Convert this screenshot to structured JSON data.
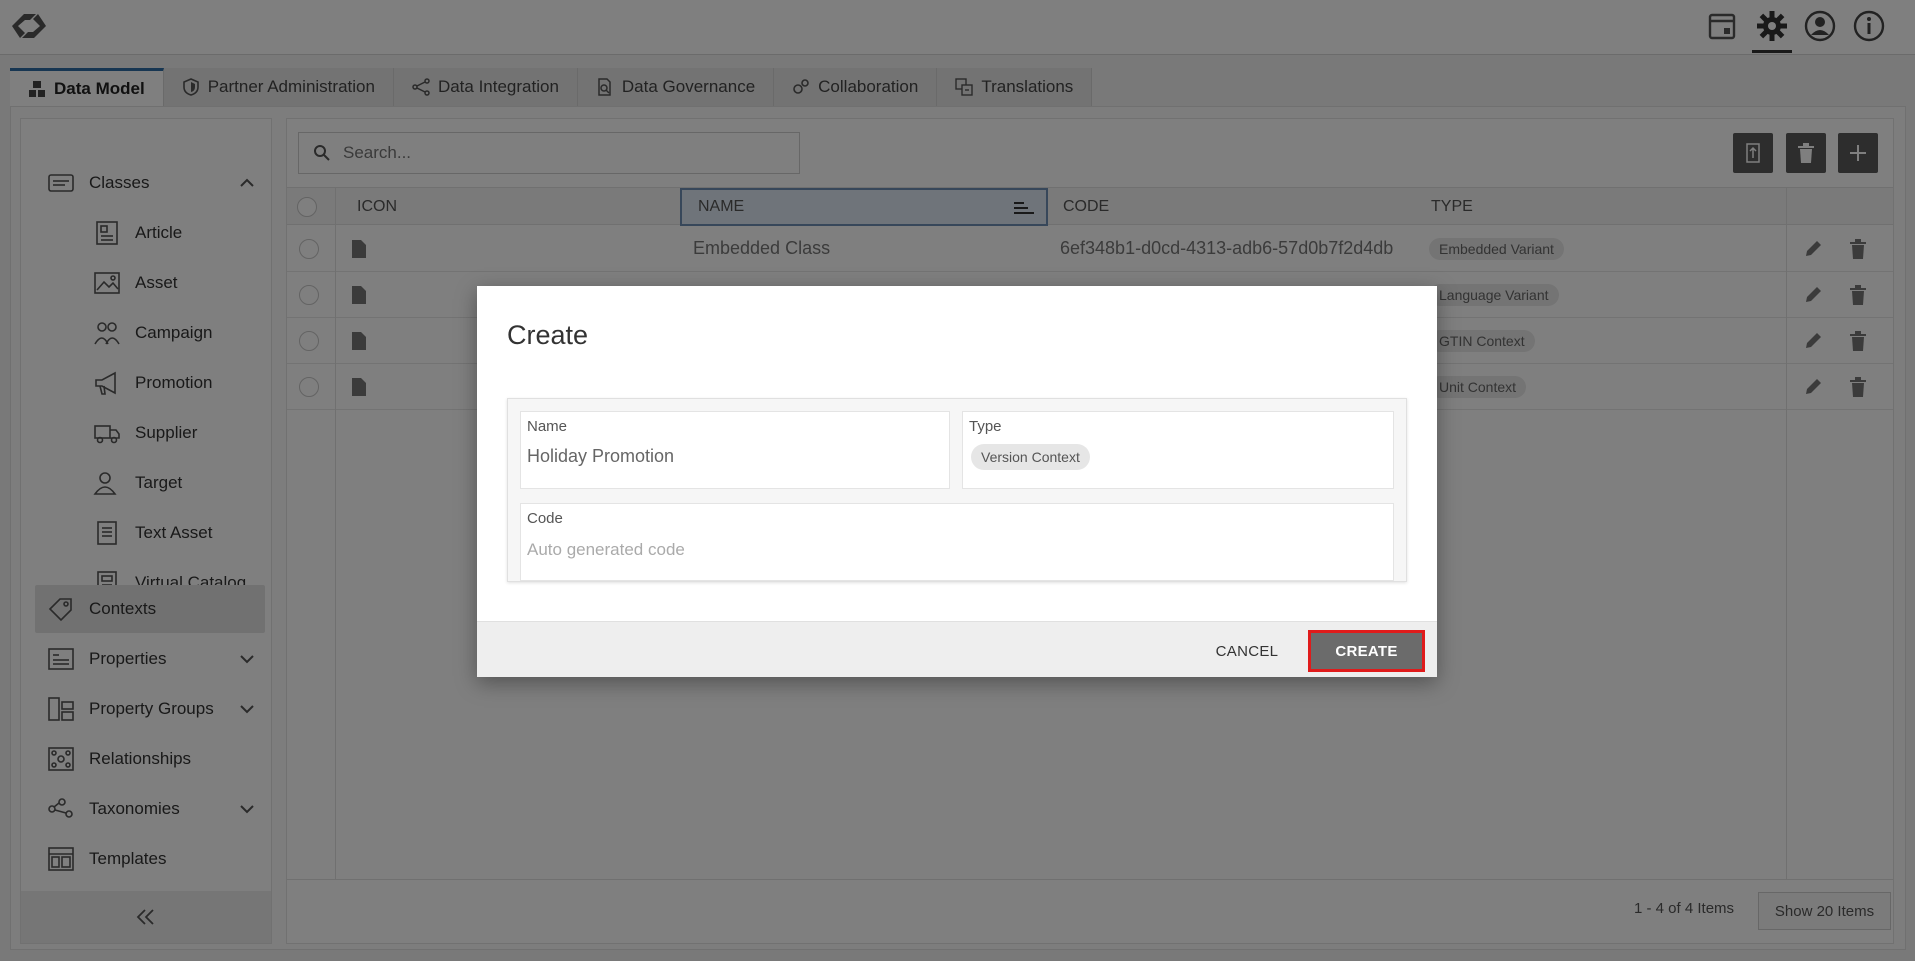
{
  "tabs": [
    {
      "label": "Data Model",
      "icon": "cubes-icon"
    },
    {
      "label": "Partner Administration",
      "icon": "shield-icon"
    },
    {
      "label": "Data Integration",
      "icon": "share-nodes-icon"
    },
    {
      "label": "Data Governance",
      "icon": "document-search-icon"
    },
    {
      "label": "Collaboration",
      "icon": "gears-icon"
    },
    {
      "label": "Translations",
      "icon": "translate-icon"
    }
  ],
  "sidebar": {
    "items": [
      {
        "label": "Classes",
        "icon": "class-icon",
        "expanded": true
      },
      {
        "label": "Article",
        "icon": "article-icon"
      },
      {
        "label": "Asset",
        "icon": "image-icon"
      },
      {
        "label": "Campaign",
        "icon": "campaign-icon"
      },
      {
        "label": "Promotion",
        "icon": "megaphone-icon"
      },
      {
        "label": "Supplier",
        "icon": "truck-icon"
      },
      {
        "label": "Target",
        "icon": "user-target-icon"
      },
      {
        "label": "Text Asset",
        "icon": "text-document-icon"
      },
      {
        "label": "Virtual Catalog",
        "icon": "catalog-icon"
      },
      {
        "label": "Contexts",
        "icon": "tag-icon",
        "selected": true
      },
      {
        "label": "Properties",
        "icon": "properties-icon"
      },
      {
        "label": "Property Groups",
        "icon": "property-groups-icon"
      },
      {
        "label": "Relationships",
        "icon": "relationships-icon"
      },
      {
        "label": "Taxonomies",
        "icon": "taxonomy-icon"
      },
      {
        "label": "Templates",
        "icon": "templates-icon"
      }
    ]
  },
  "search": {
    "placeholder": "Search..."
  },
  "grid": {
    "headers": {
      "icon": "ICON",
      "name": "NAME",
      "code": "CODE",
      "type": "TYPE"
    },
    "rows": [
      {
        "name": "Embedded Class",
        "code": "6ef348b1-d0cd-4313-adb6-57d0b7f2d4db",
        "type": "Embedded Variant"
      },
      {
        "name": "",
        "code": "",
        "type": "Language Variant"
      },
      {
        "name": "",
        "code": "",
        "type": "GTIN Context"
      },
      {
        "name": "",
        "code": "",
        "type": "Unit Context"
      }
    ],
    "footer": {
      "count": "1 - 4 of 4 Items",
      "show_label": "Show 20 Items"
    }
  },
  "modal": {
    "title": "Create",
    "name_label": "Name",
    "name_value": "Holiday Promotion",
    "type_label": "Type",
    "type_value": "Version Context",
    "code_label": "Code",
    "code_placeholder": "Auto generated code",
    "cancel_label": "CANCEL",
    "create_label": "CREATE"
  }
}
